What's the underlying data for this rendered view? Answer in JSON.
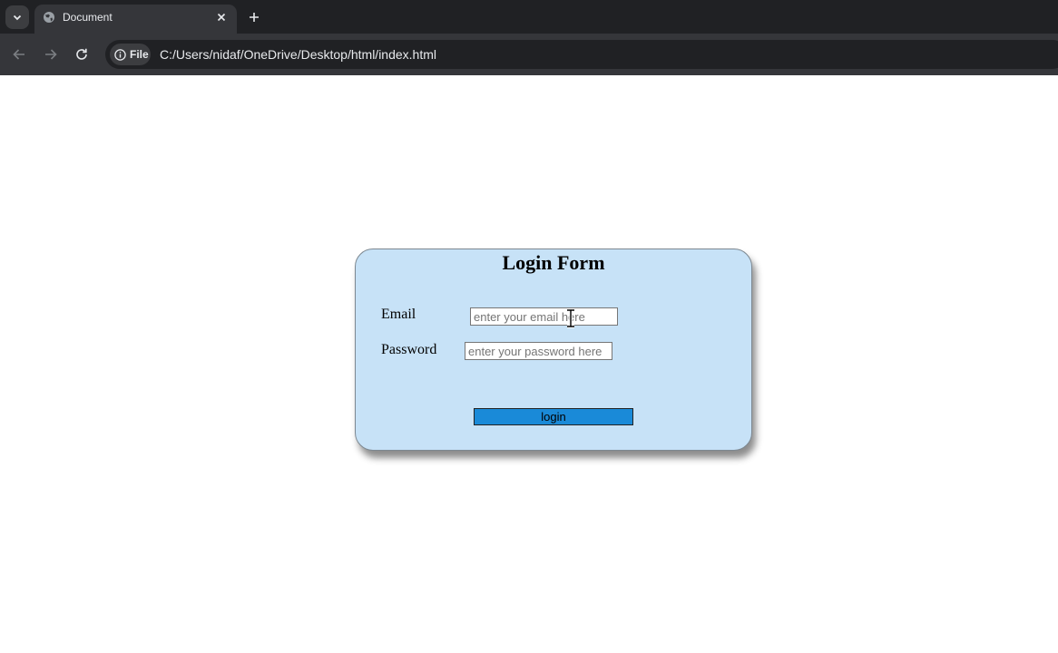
{
  "browser": {
    "tab": {
      "title": "Document",
      "close_glyph": "✕",
      "favicon": "globe-icon"
    },
    "new_tab_glyph": "+",
    "omnibox": {
      "chip_label": "File",
      "url": "C:/Users/nidaf/OneDrive/Desktop/html/index.html"
    },
    "colors": {
      "tabbar": "#202124",
      "toolbar": "#35363a",
      "text": "#e8eaed"
    }
  },
  "login_form": {
    "title": "Login Form",
    "email": {
      "label": "Email",
      "placeholder": "enter your email here",
      "value": ""
    },
    "password": {
      "label": "Password",
      "placeholder": "enter your password here",
      "value": ""
    },
    "submit_label": "login",
    "colors": {
      "card_background": "#c7e2f7",
      "button_background": "#1a8ad8"
    }
  }
}
